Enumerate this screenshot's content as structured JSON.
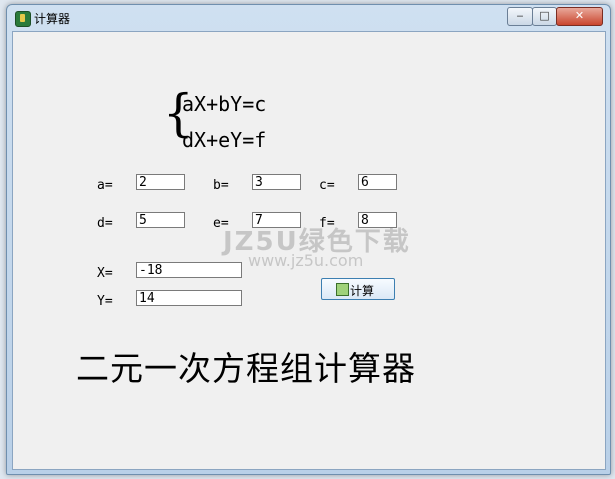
{
  "window": {
    "title": "计算器",
    "controls": {
      "minimize": "‒",
      "maximize": "□",
      "close": "✕"
    }
  },
  "equations": {
    "line1": "aX+bY=c",
    "line2": "dX+eY=f"
  },
  "fields": {
    "a": {
      "label": "a=",
      "value": "2"
    },
    "b": {
      "label": "b=",
      "value": "3"
    },
    "c": {
      "label": "c=",
      "value": "6"
    },
    "d": {
      "label": "d=",
      "value": "5"
    },
    "e": {
      "label": "e=",
      "value": "7"
    },
    "f": {
      "label": "f=",
      "value": "8"
    }
  },
  "results": {
    "x": {
      "label": "X=",
      "value": "-18"
    },
    "y": {
      "label": "Y=",
      "value": "14"
    }
  },
  "calculate_button": {
    "label": "计算",
    "icon": "calculator-icon"
  },
  "caption": "二元一次方程组计算器",
  "watermark": {
    "text": "JZ5U绿色下载",
    "url": "www.jz5u.com"
  }
}
